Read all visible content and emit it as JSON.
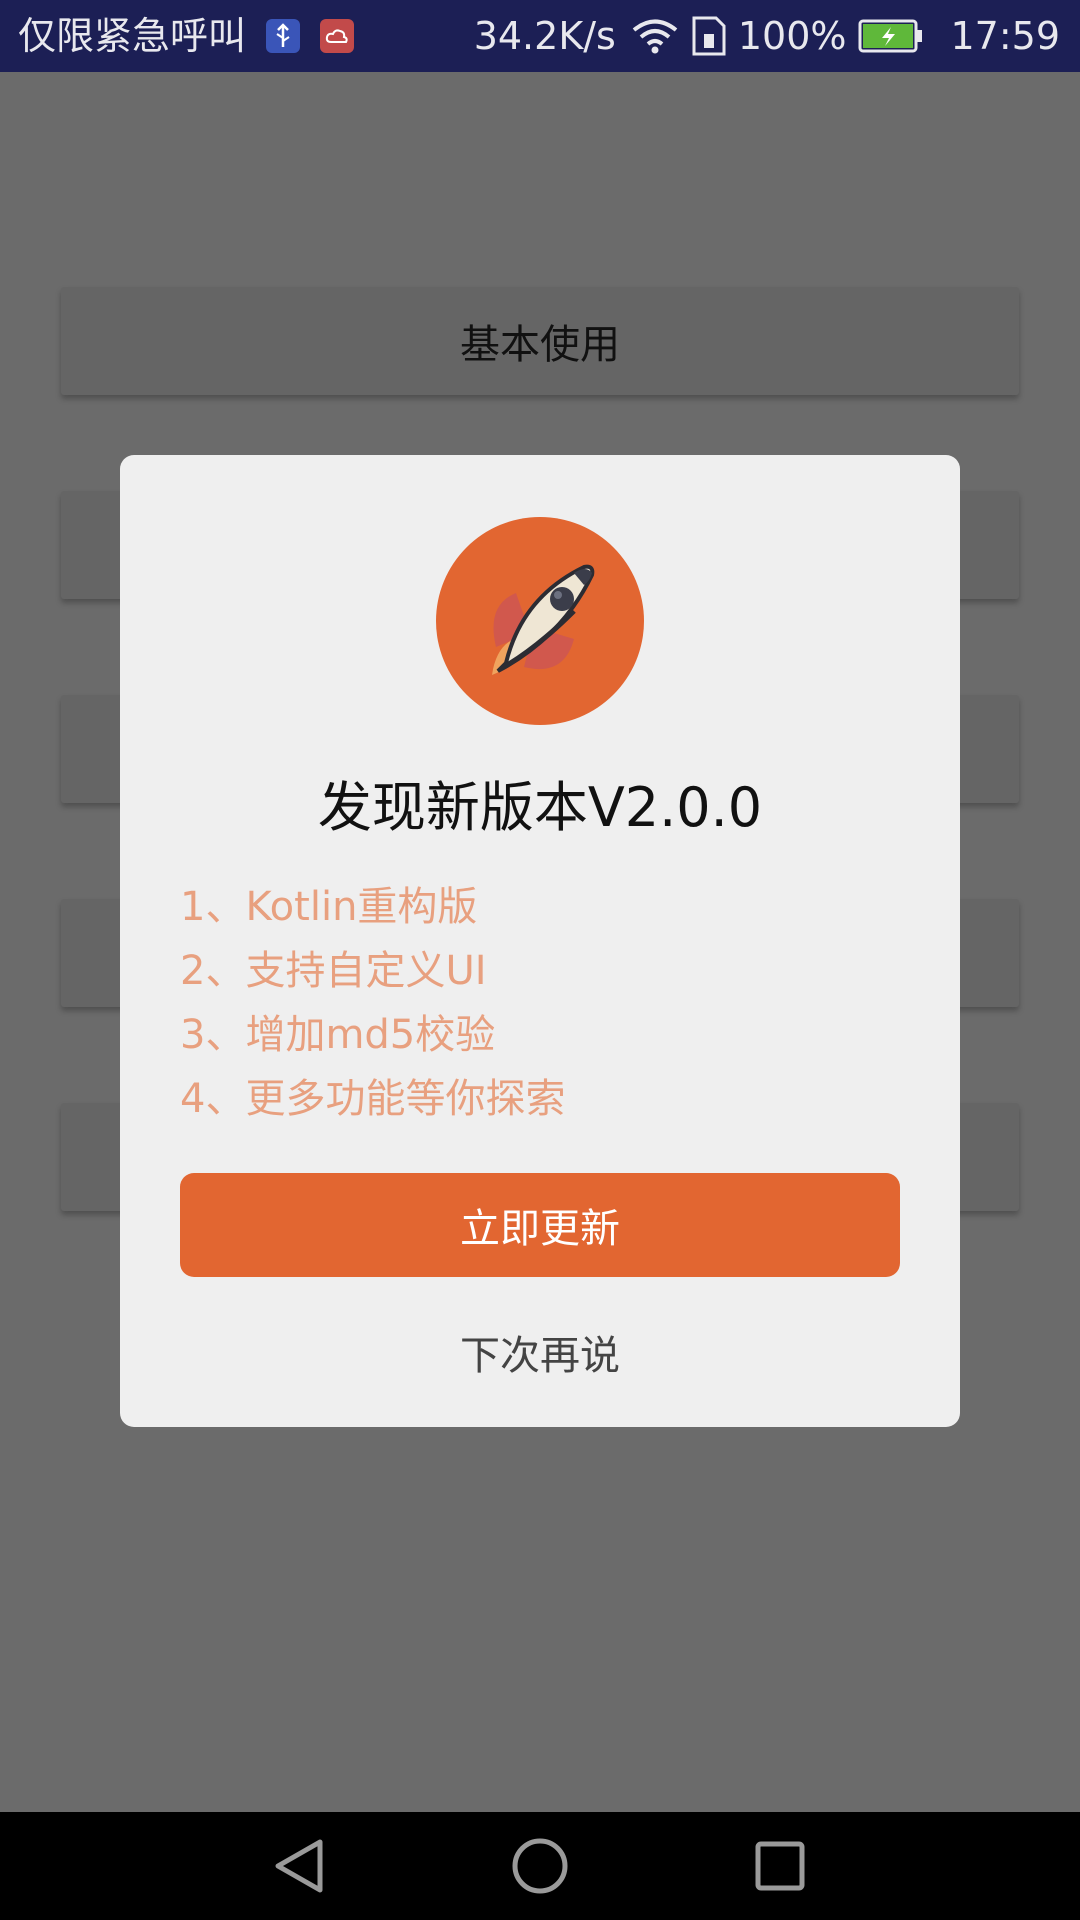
{
  "status_bar": {
    "carrier": "仅限紧急呼叫",
    "usb_icon": "usb-icon",
    "cloud_icon": "cloud-sync-icon",
    "network_speed": "34.2K/s",
    "wifi_icon": "wifi-icon",
    "sim_icon": "sim-card-icon",
    "battery_percent": "100%",
    "battery_icon": "battery-charging-icon",
    "time": "17:59",
    "colors": {
      "background": "#1c1f55",
      "text": "#e8e8ee"
    }
  },
  "background_app": {
    "first_button_label": "基本使用"
  },
  "dialog": {
    "icon": "rocket-icon",
    "title": "发现新版本V2.0.0",
    "notes": [
      "1、Kotlin重构版",
      "2、支持自定义UI",
      "3、增加md5校验",
      "4、更多功能等你探索"
    ],
    "update_button": "立即更新",
    "later_button": "下次再说",
    "colors": {
      "accent": "#e26631",
      "notes_text": "#e8a07f",
      "background": "#efefef"
    }
  },
  "nav_bar": {
    "back_icon": "back-triangle-icon",
    "home_icon": "home-circle-icon",
    "recents_icon": "recents-square-icon"
  }
}
